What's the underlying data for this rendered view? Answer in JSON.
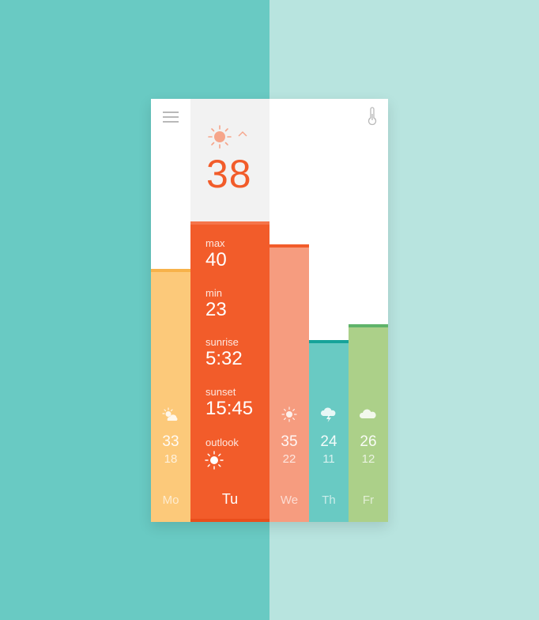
{
  "today": {
    "current_temp": "38",
    "weather_icon": "sun-icon",
    "max_label": "max",
    "max": "40",
    "min_label": "min",
    "min": "23",
    "sunrise_label": "sunrise",
    "sunrise": "5:32",
    "sunset_label": "sunset",
    "sunset": "15:45",
    "outlook_label": "outlook",
    "outlook_icon": "sun-icon",
    "day": "Tu"
  },
  "days": [
    {
      "day": "Mo",
      "high": "33",
      "low": "18",
      "icon": "partly-cloudy-icon",
      "color": "#fcc97a",
      "accent": "#f7b24a"
    },
    {
      "day": "We",
      "high": "35",
      "low": "22",
      "icon": "sun-icon",
      "color": "#f69c7f",
      "accent": "#f25c2a"
    },
    {
      "day": "Th",
      "high": "24",
      "low": "11",
      "icon": "storm-icon",
      "color": "#69cac3",
      "accent": "#16a39a"
    },
    {
      "day": "Fr",
      "high": "26",
      "low": "12",
      "icon": "cloud-icon",
      "color": "#acd089",
      "accent": "#5fb36a"
    }
  ],
  "colors": {
    "accent": "#f25c2a",
    "bg_left": "#69cac3",
    "bg_right": "#b8e4df"
  }
}
